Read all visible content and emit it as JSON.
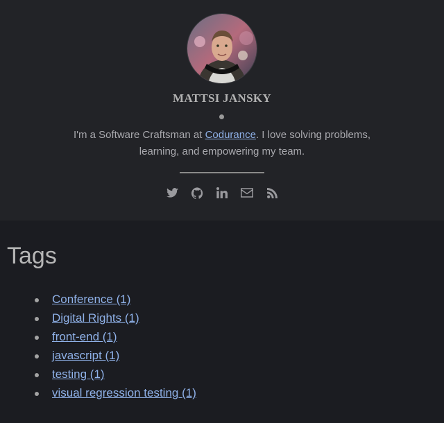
{
  "profile": {
    "name": "MATTSI JANSKY",
    "bio_prefix": "I'm a Software Craftsman at ",
    "bio_link": "Codurance",
    "bio_suffix": ". I love solving problems, learning, and empowering my team."
  },
  "social_icons": [
    "twitter-icon",
    "github-icon",
    "linkedin-icon",
    "email-icon",
    "rss-icon"
  ],
  "page": {
    "title": "Tags"
  },
  "tags": [
    {
      "label": "Conference (1)"
    },
    {
      "label": "Digital Rights (1)"
    },
    {
      "label": "front-end (1)"
    },
    {
      "label": "javascript (1)"
    },
    {
      "label": "testing (1)"
    },
    {
      "label": "visual regression testing (1)"
    }
  ],
  "colors": {
    "background": "#1b1c21",
    "header_background": "#222327",
    "link": "#8fb1e8",
    "text": "#a9a9ae"
  }
}
